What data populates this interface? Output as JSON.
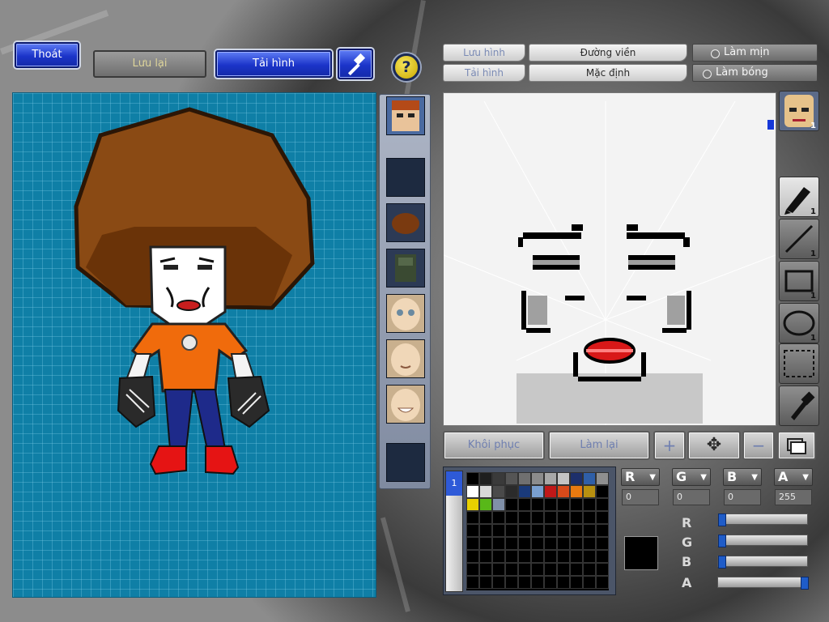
{
  "toolbar": {
    "exit_label": "Thoát",
    "save_label": "Lưu lại",
    "load_label": "Tải hình",
    "help_glyph": "?",
    "hammer_icon": "hammer-icon"
  },
  "editor_tabs": {
    "save_image": "Lưu hình",
    "outline": "Đường viền",
    "load_image": "Tải hình",
    "default": "Mặc định",
    "smooth": "Làm mịn",
    "shade": "Làm bóng"
  },
  "tools": {
    "pen_count": "1",
    "line_count": "1",
    "rect_count": "1",
    "ellipse_count": "1",
    "preview_count": "1"
  },
  "actions": {
    "restore_label": "Khôi phục",
    "redo_label": "Làm lại",
    "zoom_in_glyph": "+",
    "move_glyph": "✥",
    "zoom_out_glyph": "−"
  },
  "color": {
    "r_label": "R",
    "g_label": "G",
    "b_label": "B",
    "a_label": "A",
    "r_value": "0",
    "g_value": "0",
    "b_value": "0",
    "a_value": "255",
    "current_color": "#000000",
    "slider_r": 0,
    "slider_g": 0,
    "slider_b": 0,
    "slider_a": 1
  },
  "palette": {
    "tab_label": "1",
    "swatches": [
      "#000000",
      "#1e1e1e",
      "#3a3a3a",
      "#555555",
      "#707070",
      "#8c8c8c",
      "#a8a8a8",
      "#c4c4c4",
      "#1d2f6b",
      "#2f5fa8",
      "#8f8f8f",
      "#ffffff",
      "#d8d8d8",
      "#4a4a4a",
      "#2b2b2b",
      "#1a3a7a",
      "#7aa0d0",
      "#c01818",
      "#d84a1a",
      "#e87a10",
      "#b89010",
      "#000000",
      "#e8d000",
      "#58b818",
      "#8090a8"
    ]
  },
  "parts": [
    "face-thumbnail",
    "empty-slot",
    "hair-slot",
    "body-slot",
    "face-slot-1",
    "face-slot-2",
    "face-slot-3",
    "empty-slot"
  ]
}
